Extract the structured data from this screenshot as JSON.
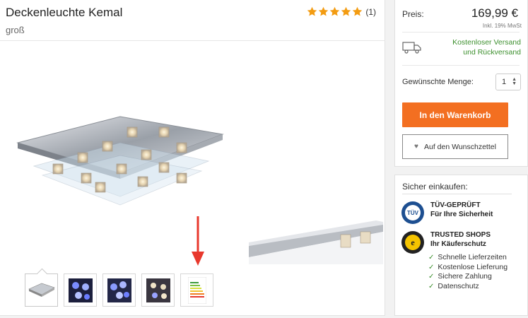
{
  "product": {
    "title": "Deckenleuchte Kemal",
    "subtitle": "groß",
    "rating_count": "(1)",
    "rating_stars": 5
  },
  "buy_box": {
    "price_label": "Preis:",
    "price_value": "169,99 €",
    "tax_note": "Inkl. 19% MwSt",
    "shipping_text_line1": "Kostenloser Versand",
    "shipping_text_line2": "und Rückversand",
    "quantity_label": "Gewünschte Menge:",
    "quantity_value": "1",
    "cart_button": "In den Warenkorb",
    "wishlist_button": "Auf den Wunschzettel"
  },
  "secure": {
    "title": "Sicher einkaufen:",
    "tuv_line1": "TÜV-GEPRÜFT",
    "tuv_line2": "Für Ihre Sicherheit",
    "tuv_badge_text": "TÜV",
    "ts_line1": "TRUSTED SHOPS",
    "ts_line2": "Ihr Käuferschutz",
    "benefits": [
      "Schnelle Lieferzeiten",
      "Kostenlose Lieferung",
      "Sichere Zahlung",
      "Datenschutz"
    ]
  },
  "colors": {
    "accent_orange": "#f36f21",
    "green": "#3c8f2d",
    "star": "#f39c12",
    "arrow_red": "#e8382d"
  }
}
